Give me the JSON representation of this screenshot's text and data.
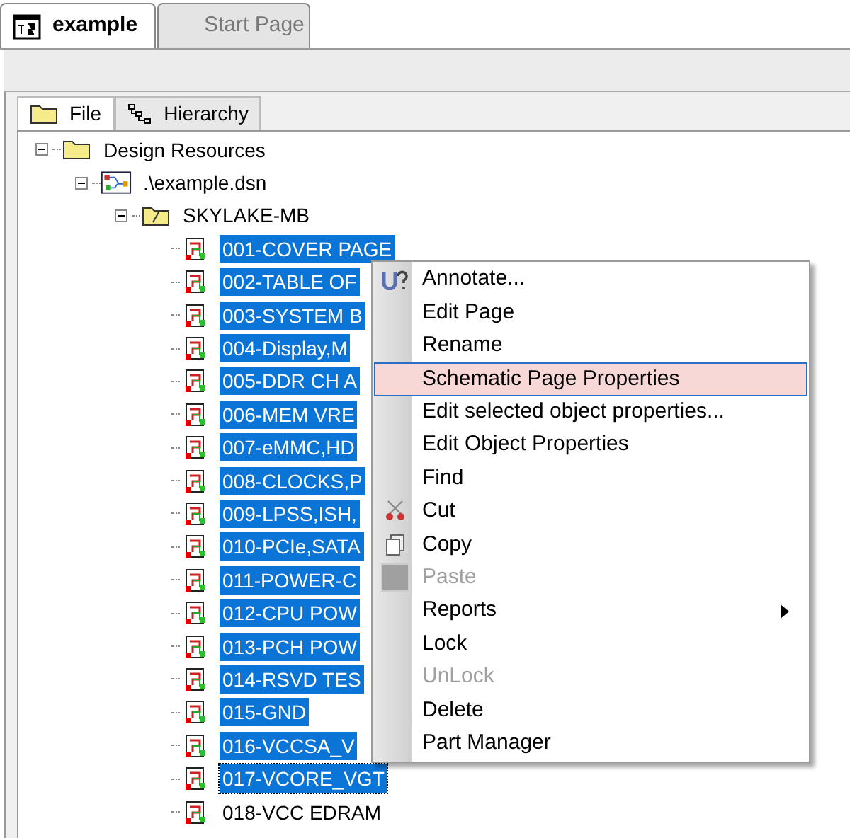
{
  "doc_tabs": [
    {
      "label": "example",
      "selected": true
    },
    {
      "label": "Start Page",
      "selected": false
    }
  ],
  "panel_tabs": [
    {
      "label": "File",
      "selected": true
    },
    {
      "label": "Hierarchy",
      "selected": false
    }
  ],
  "tree": [
    {
      "label": "Design Resources",
      "kind": "folder",
      "expanded": true,
      "selected": false,
      "focused": false,
      "children": [
        {
          "label": ".\\example.dsn",
          "kind": "design",
          "expanded": true,
          "selected": false,
          "focused": false,
          "children": [
            {
              "label": "SKYLAKE-MB",
              "kind": "openfolder",
              "expanded": true,
              "selected": false,
              "focused": false,
              "children": [
                {
                  "label": "001-COVER PAGE",
                  "kind": "page",
                  "selected": true,
                  "focused": false
                },
                {
                  "label": "002-TABLE OF",
                  "kind": "page",
                  "selected": true,
                  "focused": false
                },
                {
                  "label": "003-SYSTEM B",
                  "kind": "page",
                  "selected": true,
                  "focused": false
                },
                {
                  "label": "004-Display,M",
                  "kind": "page",
                  "selected": true,
                  "focused": false
                },
                {
                  "label": "005-DDR CH A",
                  "kind": "page",
                  "selected": true,
                  "focused": false
                },
                {
                  "label": "006-MEM VRE",
                  "kind": "page",
                  "selected": true,
                  "focused": false
                },
                {
                  "label": "007-eMMC,HD",
                  "kind": "page",
                  "selected": true,
                  "focused": false
                },
                {
                  "label": "008-CLOCKS,P",
                  "kind": "page",
                  "selected": true,
                  "focused": false
                },
                {
                  "label": "009-LPSS,ISH,",
                  "kind": "page",
                  "selected": true,
                  "focused": false
                },
                {
                  "label": "010-PCIe,SATA",
                  "kind": "page",
                  "selected": true,
                  "focused": false
                },
                {
                  "label": "011-POWER-C",
                  "kind": "page",
                  "selected": true,
                  "focused": false
                },
                {
                  "label": "012-CPU POW",
                  "kind": "page",
                  "selected": true,
                  "focused": false
                },
                {
                  "label": "013-PCH POW",
                  "kind": "page",
                  "selected": true,
                  "focused": false
                },
                {
                  "label": "014-RSVD TES",
                  "kind": "page",
                  "selected": true,
                  "focused": false
                },
                {
                  "label": "015-GND",
                  "kind": "page",
                  "selected": true,
                  "focused": false
                },
                {
                  "label": "016-VCCSA_V",
                  "kind": "page",
                  "selected": true,
                  "focused": false
                },
                {
                  "label": "017-VCORE_VGT",
                  "kind": "page",
                  "selected": true,
                  "focused": true
                },
                {
                  "label": "018-VCC EDRAM",
                  "kind": "page",
                  "selected": false,
                  "focused": false
                }
              ]
            }
          ]
        }
      ]
    }
  ],
  "context_menu": [
    {
      "label": "Annotate...",
      "selected": false,
      "disabled": false,
      "submenu": false
    },
    {
      "label": "Edit Page",
      "selected": false,
      "disabled": false,
      "submenu": false
    },
    {
      "label": "Rename",
      "selected": false,
      "disabled": false,
      "submenu": false
    },
    {
      "label": "Schematic Page Properties",
      "selected": true,
      "disabled": false,
      "submenu": false
    },
    {
      "label": "Edit selected object properties...",
      "selected": false,
      "disabled": false,
      "submenu": false
    },
    {
      "label": "Edit Object Properties",
      "selected": false,
      "disabled": false,
      "submenu": false
    },
    {
      "label": "Find",
      "selected": false,
      "disabled": false,
      "submenu": false
    },
    {
      "label": "Cut",
      "selected": false,
      "disabled": false,
      "submenu": false
    },
    {
      "label": "Copy",
      "selected": false,
      "disabled": false,
      "submenu": false
    },
    {
      "label": "Paste",
      "selected": false,
      "disabled": true,
      "submenu": false
    },
    {
      "label": "Reports",
      "selected": false,
      "disabled": false,
      "submenu": true
    },
    {
      "label": "Lock",
      "selected": false,
      "disabled": false,
      "submenu": false
    },
    {
      "label": "UnLock",
      "selected": false,
      "disabled": true,
      "submenu": false
    },
    {
      "label": "Delete",
      "selected": false,
      "disabled": false,
      "submenu": false
    },
    {
      "label": "Part Manager",
      "selected": false,
      "disabled": false,
      "submenu": false
    }
  ]
}
